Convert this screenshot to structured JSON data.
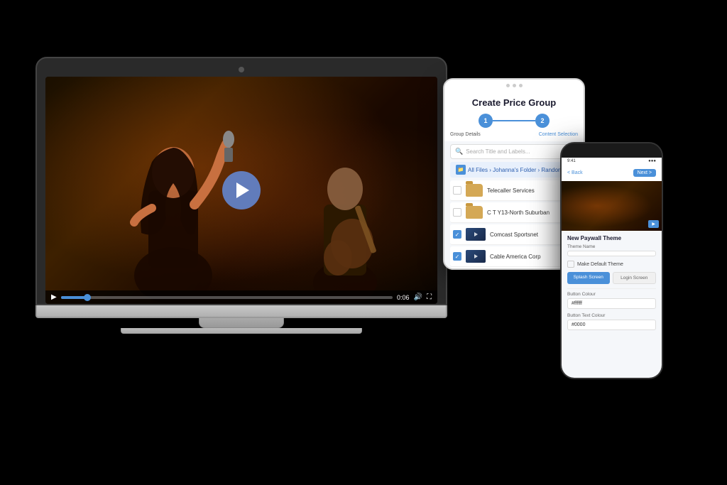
{
  "scene": {
    "bg_color": "#000000"
  },
  "laptop": {
    "camera_label": "camera",
    "video": {
      "controls": {
        "play_btn_label": "Play",
        "time": "0:06",
        "volume_label": "Volume",
        "fullscreen_label": "Fullscreen"
      }
    }
  },
  "tablet": {
    "title": "Create Price Group",
    "stepper": {
      "step1_label": "Group Details",
      "step2_label": "Content Selection",
      "step1_num": "1",
      "step2_num": "2"
    },
    "search_placeholder": "Search Title and Labels...",
    "breadcrumb": "All Files › Johanna's Folder › Random",
    "files": [
      {
        "name": "Telecaller Services",
        "type": "folder",
        "checked": false
      },
      {
        "name": "C T Y13-North Suburban",
        "type": "folder",
        "checked": false
      },
      {
        "name": "Comcast Sportsnet",
        "type": "video",
        "checked": true
      },
      {
        "name": "Cable America Corp",
        "type": "video",
        "checked": true
      }
    ]
  },
  "phone": {
    "status_bar": {
      "time": "9:41",
      "signal": "●●●",
      "battery": "▓▓"
    },
    "header": {
      "back_label": "< Back",
      "next_label": "Next >"
    },
    "section_title": "New Paywall Theme",
    "form": {
      "theme_name_label": "Theme Name",
      "theme_name_placeholder": "",
      "default_label": "Make Default Theme",
      "btn_splash": "Splash Screen",
      "btn_login": "Login Screen",
      "button_colour_label": "Button Colour",
      "button_colour_value": "#ffffff",
      "button_text_colour_label": "Button Text Colour",
      "button_text_colour_value": "#0000"
    }
  }
}
